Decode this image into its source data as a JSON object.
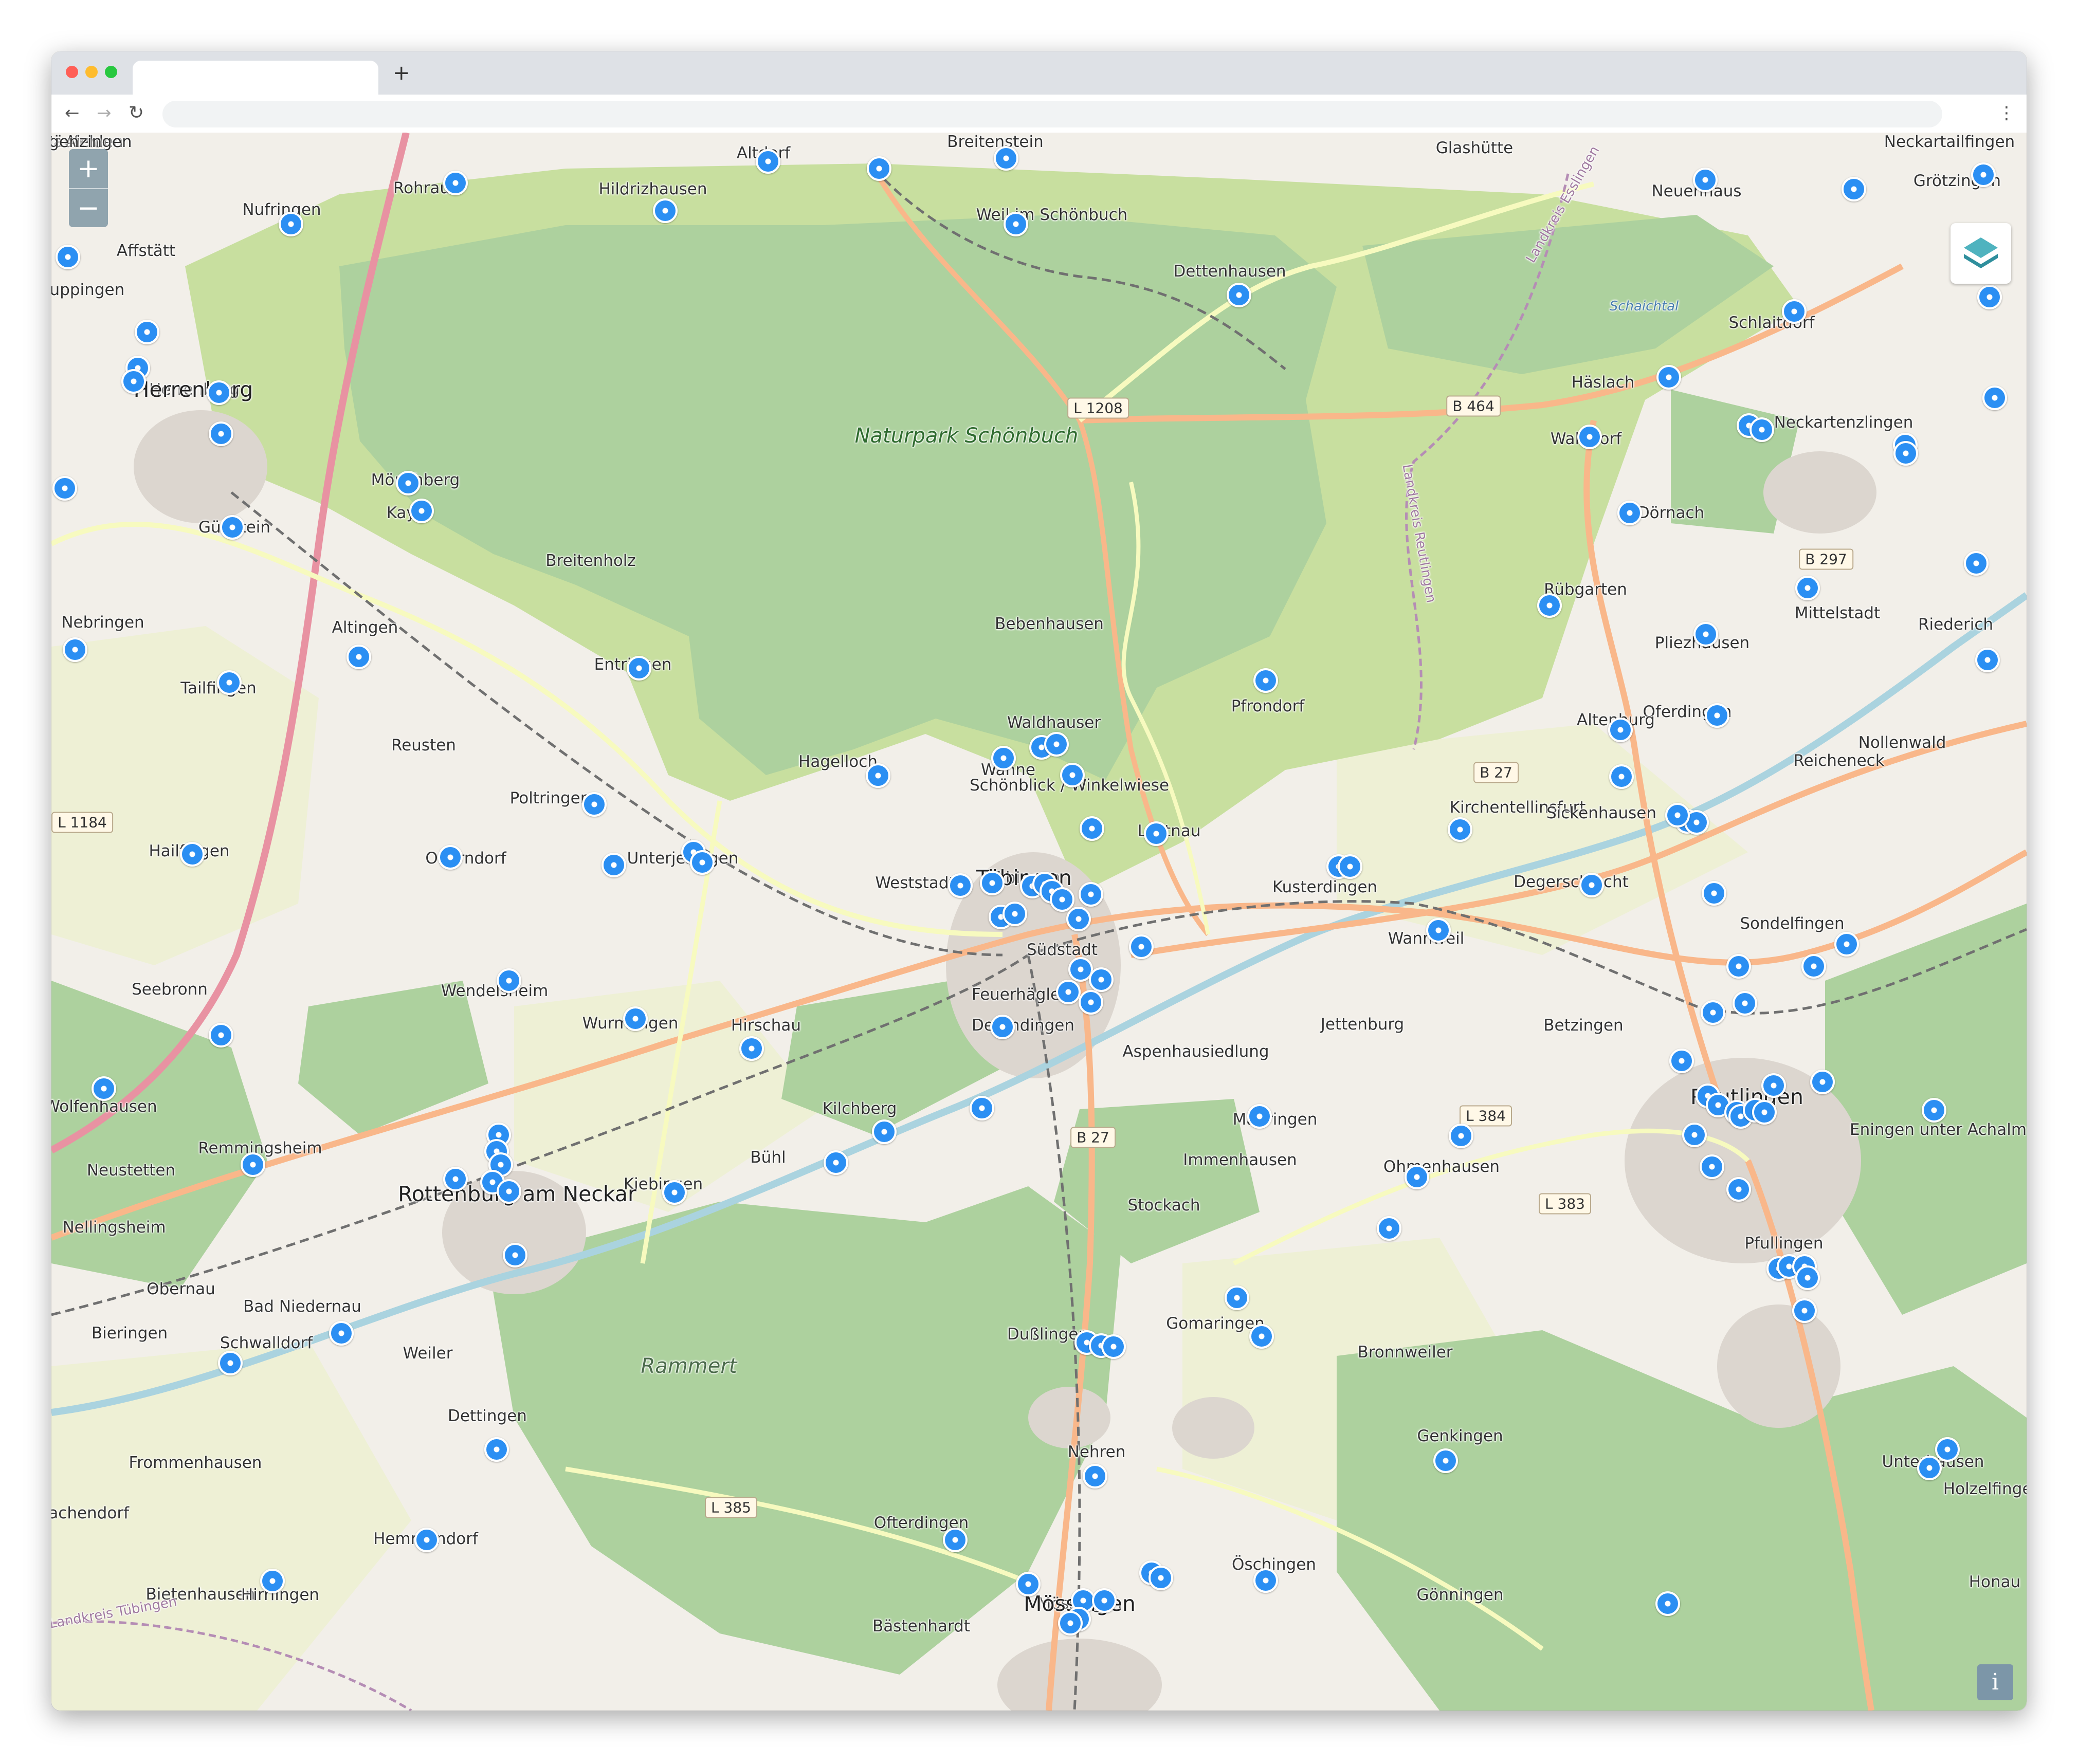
{
  "browser": {
    "tab_title": "",
    "new_tab": "+",
    "url": "",
    "back_icon": "←",
    "forward_icon": "→",
    "reload_icon": "↻",
    "menu_icon": "⋮"
  },
  "controls": {
    "zoom_in": "+",
    "zoom_out": "−",
    "info": "i",
    "layers_icon": "layers-icon"
  },
  "colors": {
    "marker": "#2b8ff3",
    "forest": "#add19e",
    "park": "#c8df9f",
    "motorway": "#e892a2",
    "primary_road": "#f9b78a",
    "secondary_road": "#f7fabf",
    "railway": "#707070",
    "water": "#aad3df"
  },
  "labels": {
    "places": [
      "Altdorf",
      "Breitenstein",
      "Glashütte",
      "Neuenhaus",
      "Grötzingen",
      "Rohrau",
      "Hildrizhausen",
      "Weil im Schönbuch",
      "Nufringen",
      "Gäufelden",
      "Affstätt",
      "Dettenhausen",
      "Schlaitdorf",
      "Herrenberg",
      "Neckartailfingen",
      "Aich",
      "Häslach",
      "Walddorf",
      "Neckartenzlingen",
      "Mönchberg",
      "Kayh",
      "Gültstein",
      "Dörnach",
      "Breitenholz",
      "Bebenhausen",
      "Rübgarten",
      "Mittelstadt",
      "Nebringen",
      "Altingen",
      "Pliezhausen",
      "Riederich",
      "Entringen",
      "Tailfingen",
      "Pfrondorf",
      "Oferdingen",
      "Altenburg",
      "Reicheneck",
      "Reusten",
      "Waldhauser",
      "Hagelloch",
      "Wanne",
      "Schönblick / Winkelwiese",
      "Poltringen",
      "Kirchentellinsfurt",
      "Sickenhausen",
      "Hailfingen",
      "Oberndorf",
      "Unterjesingen",
      "Lustnau",
      "Weststadt",
      "Degerschlacht",
      "Kusterdingen",
      "Sondelfingen",
      "Wannweil",
      "Südstadt",
      "Seebronn",
      "Wendelsheim",
      "Feuerhägle",
      "Wurmlingen",
      "Hirschau",
      "Derendingen",
      "Jettenburg",
      "Betzingen",
      "Aspenhausiedlung",
      "Wolfenhausen",
      "Kilchberg",
      "Mähringen",
      "Eningen unter Achalm",
      "Remmingsheim",
      "Immenhausen",
      "Neustetten",
      "Ohmenhausen",
      "Bühl",
      "Kiebingen",
      "Stockach",
      "Nellingsheim",
      "Pfullingen",
      "Obernau",
      "Bad Niedernau",
      "Gomaringen",
      "Dußlingen",
      "Bieringen",
      "Schwalldorf",
      "Weiler",
      "Bronnweiler",
      "Dettingen",
      "Nehren",
      "Genkingen",
      "Unterhausen",
      "Holzelfingen",
      "Frommenhausen",
      "Ofterdingen",
      "Bachendorf",
      "Hemmendorf",
      "Öschingen",
      "Bietenhausen",
      "Hirrlingen",
      "Mössingen",
      "Gönningen",
      "Honau",
      "Bästenhardt",
      "Ergenzingen",
      "Kuppingen",
      "Nollenwald",
      "Tübingen"
    ],
    "cities": [
      "Herrenberg",
      "Rottenburg am Neckar",
      "Tübingen",
      "Reutlingen",
      "Mössingen"
    ],
    "park": "Naturpark Schönbuch",
    "forest": "Rammert",
    "water": "Schaichtal",
    "admin": [
      "Landkreis Esslingen",
      "Landkreis Reutlingen",
      "Landkreis Tübingen"
    ]
  },
  "road_shields": [
    "L 1208",
    "B 464",
    "B 297",
    "B 27",
    "L 1184",
    "L 384",
    "B 27",
    "L 383",
    "L 385"
  ],
  "markers": {
    "count": 150
  }
}
